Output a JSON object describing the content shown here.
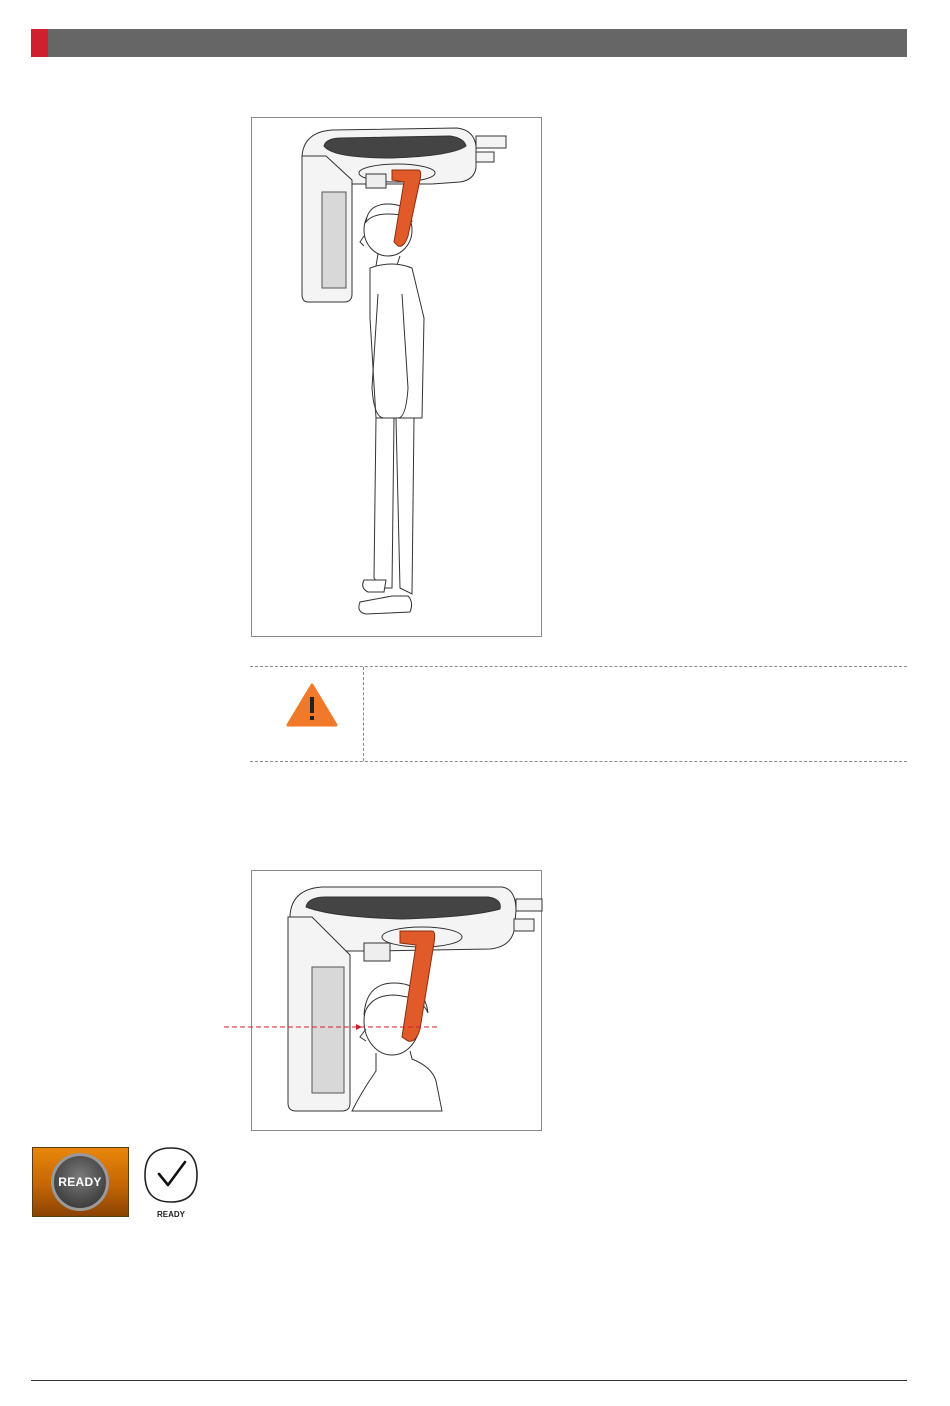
{
  "colors": {
    "header_bar": "#666666",
    "header_accent": "#d0202e",
    "headrest": "#e05a2a",
    "warning": "#f07a2a",
    "laser_line": "#d0202e",
    "ready_orange": "#d97506"
  },
  "figures": [
    {
      "id": "full-body-positioning",
      "description_icon": "patient-standing-in-unit-illustration"
    },
    {
      "id": "head-alignment-laser",
      "description_icon": "patient-head-laser-alignment-illustration"
    }
  ],
  "caution": {
    "icon": "warning-triangle-icon"
  },
  "ready_controls": {
    "button_label": "READY",
    "check_label": "READY",
    "check_icon": "checkmark-icon"
  }
}
